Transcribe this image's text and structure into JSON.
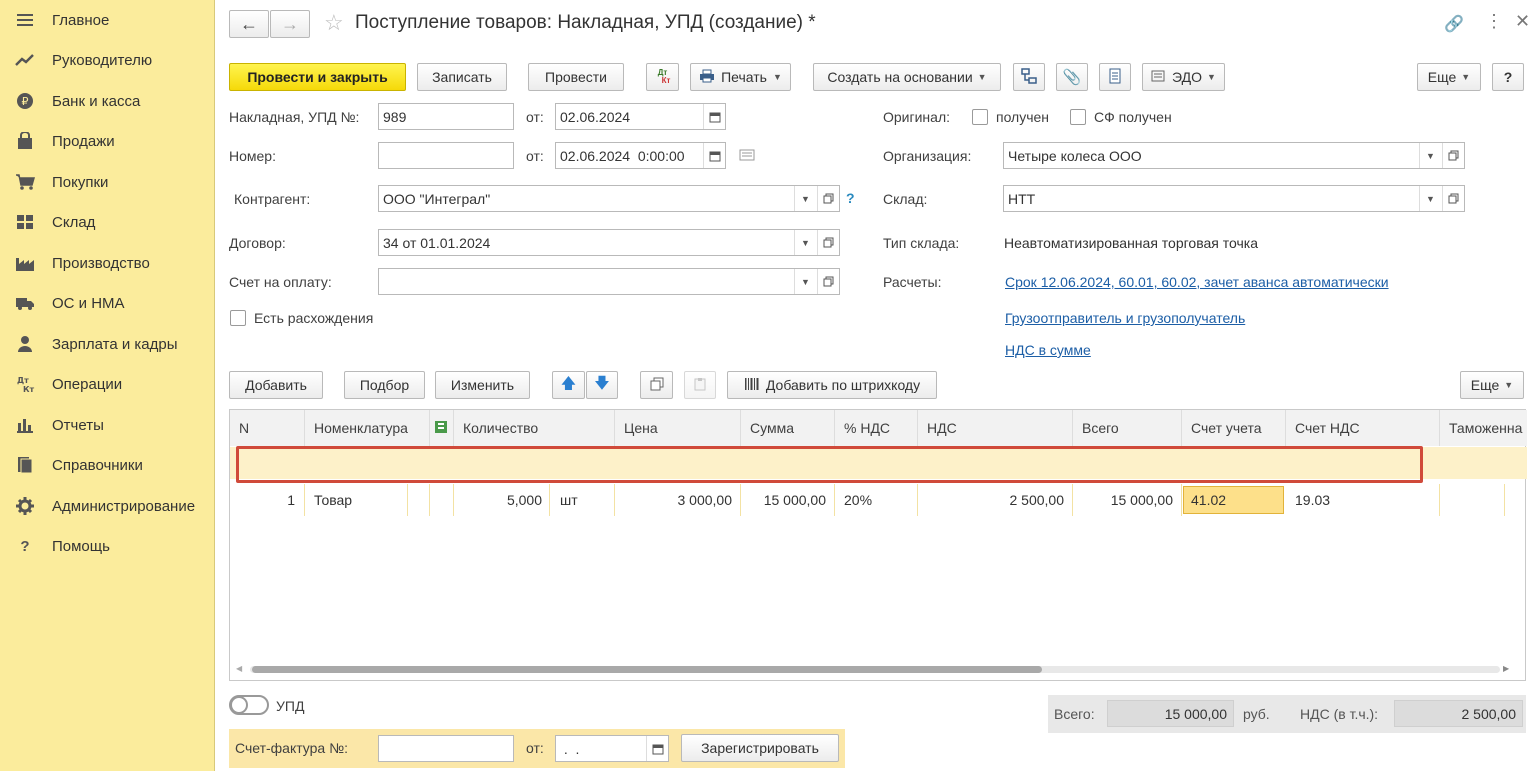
{
  "sidebar": {
    "items": [
      {
        "label": "Главное",
        "icon": "menu-icon"
      },
      {
        "label": "Руководителю",
        "icon": "trend-icon"
      },
      {
        "label": "Банк и касса",
        "icon": "ruble-icon"
      },
      {
        "label": "Продажи",
        "icon": "bag-icon"
      },
      {
        "label": "Покупки",
        "icon": "cart-icon"
      },
      {
        "label": "Склад",
        "icon": "warehouse-icon"
      },
      {
        "label": "Производство",
        "icon": "factory-icon"
      },
      {
        "label": "ОС и НМА",
        "icon": "truck-icon"
      },
      {
        "label": "Зарплата и кадры",
        "icon": "person-icon"
      },
      {
        "label": "Операции",
        "icon": "dt-kt-icon"
      },
      {
        "label": "Отчеты",
        "icon": "bar-chart-icon"
      },
      {
        "label": "Справочники",
        "icon": "books-icon"
      },
      {
        "label": "Администрирование",
        "icon": "gear-icon"
      },
      {
        "label": "Помощь",
        "icon": "question-icon"
      }
    ]
  },
  "header": {
    "title": "Поступление товаров: Накладная, УПД (создание) *"
  },
  "toolbar": {
    "post_close": "Провести и закрыть",
    "save": "Записать",
    "post": "Провести",
    "dtkt_top": "Дт",
    "dtkt_bottom": "Кт",
    "print": "Печать",
    "create_based": "Создать на основании",
    "edo": "ЭДО",
    "more": "Еще",
    "help": "?"
  },
  "form": {
    "invoice_label": "Накладная, УПД №:",
    "invoice_no": "989",
    "from_label": "от:",
    "invoice_date": "02.06.2024",
    "number_label": "Номер:",
    "number_value": "",
    "number_date": "02.06.2024  0:00:00",
    "counterparty_label": "Контрагент:",
    "counterparty": "ООО \"Интеграл\"",
    "counterparty_help": "?",
    "contract_label": "Договор:",
    "contract": "34 от 01.01.2024",
    "payment_label": "Счет на оплату:",
    "payment": "",
    "discrepancy_label": "Есть расхождения",
    "original_label": "Оригинал:",
    "received": "получен",
    "sf_received": "СФ получен",
    "org_label": "Организация:",
    "org": "Четыре колеса ООО",
    "warehouse_label": "Склад:",
    "warehouse": "НТТ",
    "wh_type_label": "Тип склада:",
    "wh_type": "Неавтоматизированная торговая точка",
    "settlements_label": "Расчеты:",
    "settlements_link": "Срок 12.06.2024, 60.01, 60.02, зачет аванса автоматически",
    "shipper_link": "Грузоотправитель и грузополучатель",
    "vat_link": "НДС в сумме"
  },
  "table_toolbar": {
    "add": "Добавить",
    "pick": "Подбор",
    "edit": "Изменить",
    "barcode": "Добавить по штрихкоду",
    "more": "Еще"
  },
  "table": {
    "columns": [
      "N",
      "Номенклатура",
      "",
      "Количество",
      "Цена",
      "Сумма",
      "% НДС",
      "НДС",
      "Всего",
      "Счет учета",
      "Счет НДС",
      "Таможенна"
    ],
    "rows": [
      {
        "n": "1",
        "item": "Товар",
        "qty": "5,000",
        "unit": "шт",
        "price": "3 000,00",
        "sum": "15 000,00",
        "vat_rate": "20%",
        "vat": "2 500,00",
        "total": "15 000,00",
        "account": "41.02",
        "vat_account": "19.03"
      }
    ]
  },
  "footer": {
    "upd_label": "УПД",
    "total_label": "Всего:",
    "total": "15 000,00",
    "currency": "руб.",
    "vat_label": "НДС (в т.ч.):",
    "vat": "2 500,00",
    "invoice_label": "Счет-фактура №:",
    "invoice_no": "",
    "from_label": "от:",
    "invoice_date": " .  .",
    "register": "Зарегистрировать"
  },
  "colors": {
    "sidebar": "#fbec9c",
    "primary_btn": "#f5d909",
    "row_highlight": "#fdf1c9",
    "selected_cell": "#fde08a",
    "red_frame": "#d04a3a",
    "link": "#1c5ea6"
  }
}
